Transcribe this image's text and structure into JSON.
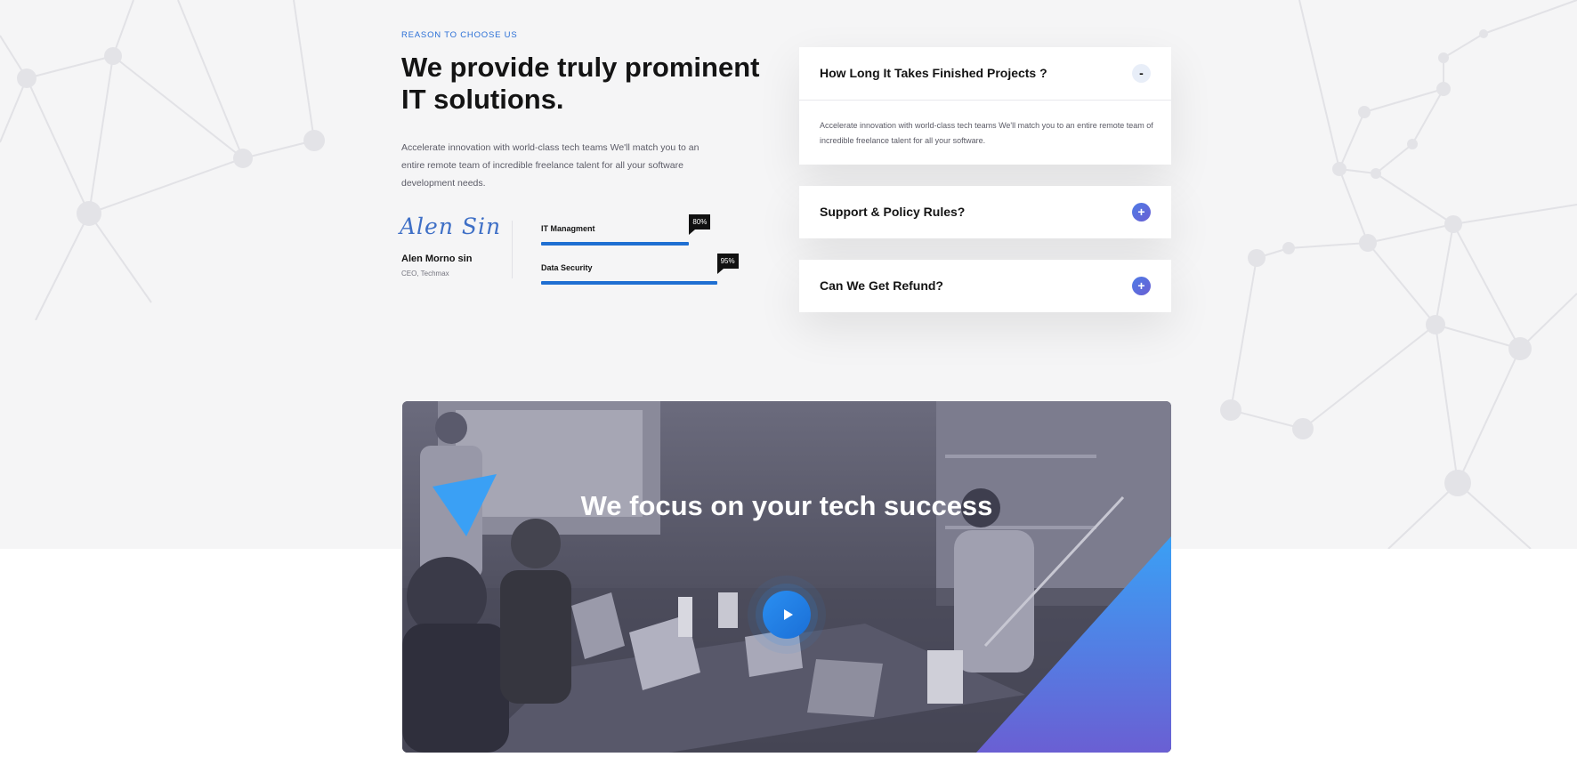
{
  "section": {
    "eyebrow": "REASON TO CHOOSE US",
    "heading": "We provide truly prominent IT solutions.",
    "description": "Accelerate innovation with world-class tech teams We'll match you to an entire remote team of incredible freelance talent for all your software development needs."
  },
  "ceo": {
    "signature": "Alen Sin",
    "name": "Alen Morno sin",
    "role": "CEO, Techmax"
  },
  "skills": [
    {
      "label": "IT Managment",
      "percent_text": "80%",
      "value": 80
    },
    {
      "label": "Data Security",
      "percent_text": "95%",
      "value": 95
    }
  ],
  "faq": [
    {
      "question": "How Long It Takes Finished Projects ?",
      "toggle": "-",
      "expanded": true,
      "answer": "Accelerate innovation with world-class tech teams We'll match you to an entire remote team of incredible freelance talent for all your software."
    },
    {
      "question": "Support & Policy Rules?",
      "toggle": "+",
      "expanded": false
    },
    {
      "question": "Can We Get Refund?",
      "toggle": "+",
      "expanded": false
    }
  ],
  "video": {
    "title": "We focus on your tech success",
    "play_icon": "play-icon"
  },
  "colors": {
    "accent": "#1f6fd2",
    "accent_gradient_start": "#3aa0f5",
    "accent_gradient_end": "#6a5fd3",
    "badge_bg": "#111111"
  }
}
